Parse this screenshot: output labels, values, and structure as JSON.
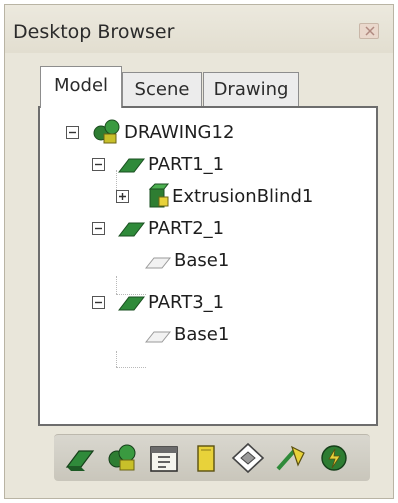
{
  "window": {
    "title": "Desktop Browser"
  },
  "tabs": [
    {
      "label": "Model",
      "active": true
    },
    {
      "label": "Scene",
      "active": false
    },
    {
      "label": "Drawing",
      "active": false
    }
  ],
  "tree": {
    "root": {
      "label": "DRAWING12",
      "expanded": true,
      "icon": "assembly-icon"
    },
    "items": [
      {
        "label": "PART1_1",
        "expanded": true,
        "icon": "part-icon"
      },
      {
        "label": "ExtrusionBlind1",
        "expanded": false,
        "icon": "extrusion-icon"
      },
      {
        "label": "PART2_1",
        "expanded": true,
        "icon": "part-icon"
      },
      {
        "label": "Base1",
        "icon": "base-sketch-icon"
      },
      {
        "label": "PART3_1",
        "expanded": true,
        "icon": "part-icon"
      },
      {
        "label": "Base1",
        "icon": "base-sketch-icon"
      }
    ]
  },
  "toolbar": {
    "buttons": [
      "new-part-icon",
      "new-assembly-icon",
      "catalog-icon",
      "drawing-sheet-icon",
      "work-plane-icon",
      "measure-icon",
      "update-icon"
    ]
  },
  "colors": {
    "panel_bg": "#e9e6da",
    "tree_bg": "#ffffff",
    "part_green": "#2f8a3a",
    "accent_yellow": "#e8d23a"
  }
}
